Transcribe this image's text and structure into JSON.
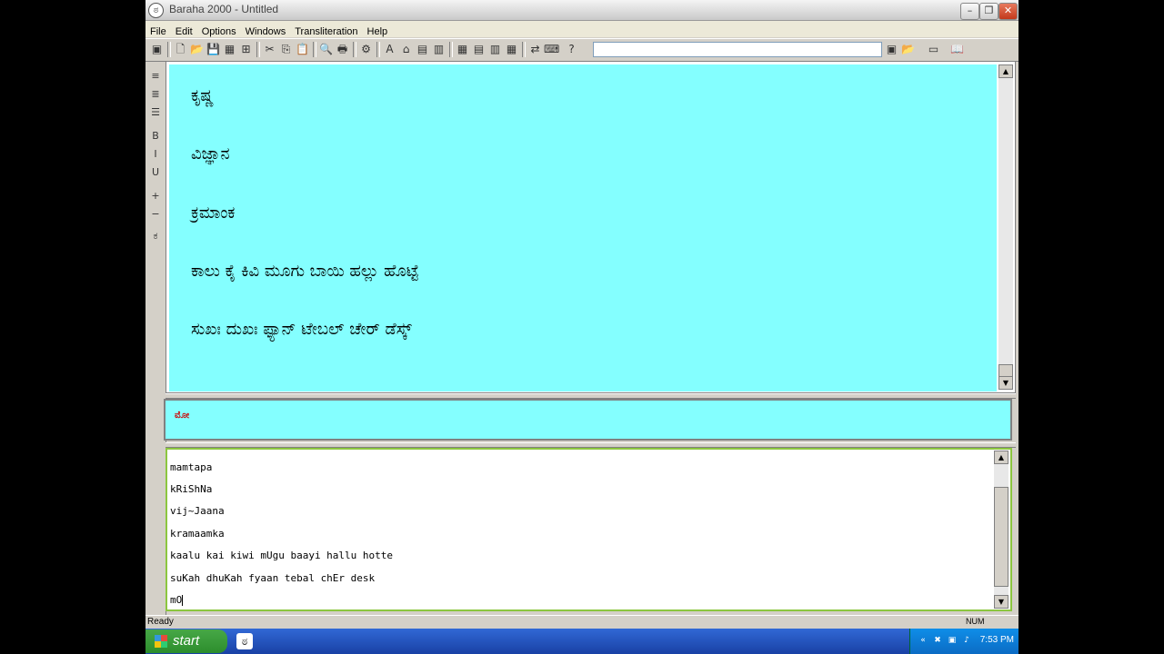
{
  "window": {
    "title": "Baraha 2000 - Untitled"
  },
  "menu": [
    "File",
    "Edit",
    "Options",
    "Windows",
    "Transliteration",
    "Help"
  ],
  "kannada_lines": [
    "ಕೃಷ್ಣ",
    "ವಿಜ್ಞಾನ",
    "ಕ್ರಮಾಂಕ",
    "ಕಾಲು ಕೈ ಕಿವಿ ಮೂಗು ಬಾಯಿ ಹಲ್ಲು ಹೊಟ್ಟೆ",
    "ಸುಖಃ ದುಖಃ ಫ್ಯಾನ್ ಟೇಬಲ್ ಚೇರ್ ಡೆಸ್ಕ್"
  ],
  "preview_text": "ಮೋ",
  "input_lines": [
    "mamtapa",
    "kRiShNa",
    "vij~Jaana",
    "kramaamka",
    "kaalu kai kiwi mUgu baayi hallu hotte",
    "suKah dhuKah fyaan tebal chEr desk",
    "mO"
  ],
  "status": {
    "left": "Ready",
    "num": "NUM"
  },
  "taskbar": {
    "start": "start",
    "clock": "7:53 PM"
  }
}
